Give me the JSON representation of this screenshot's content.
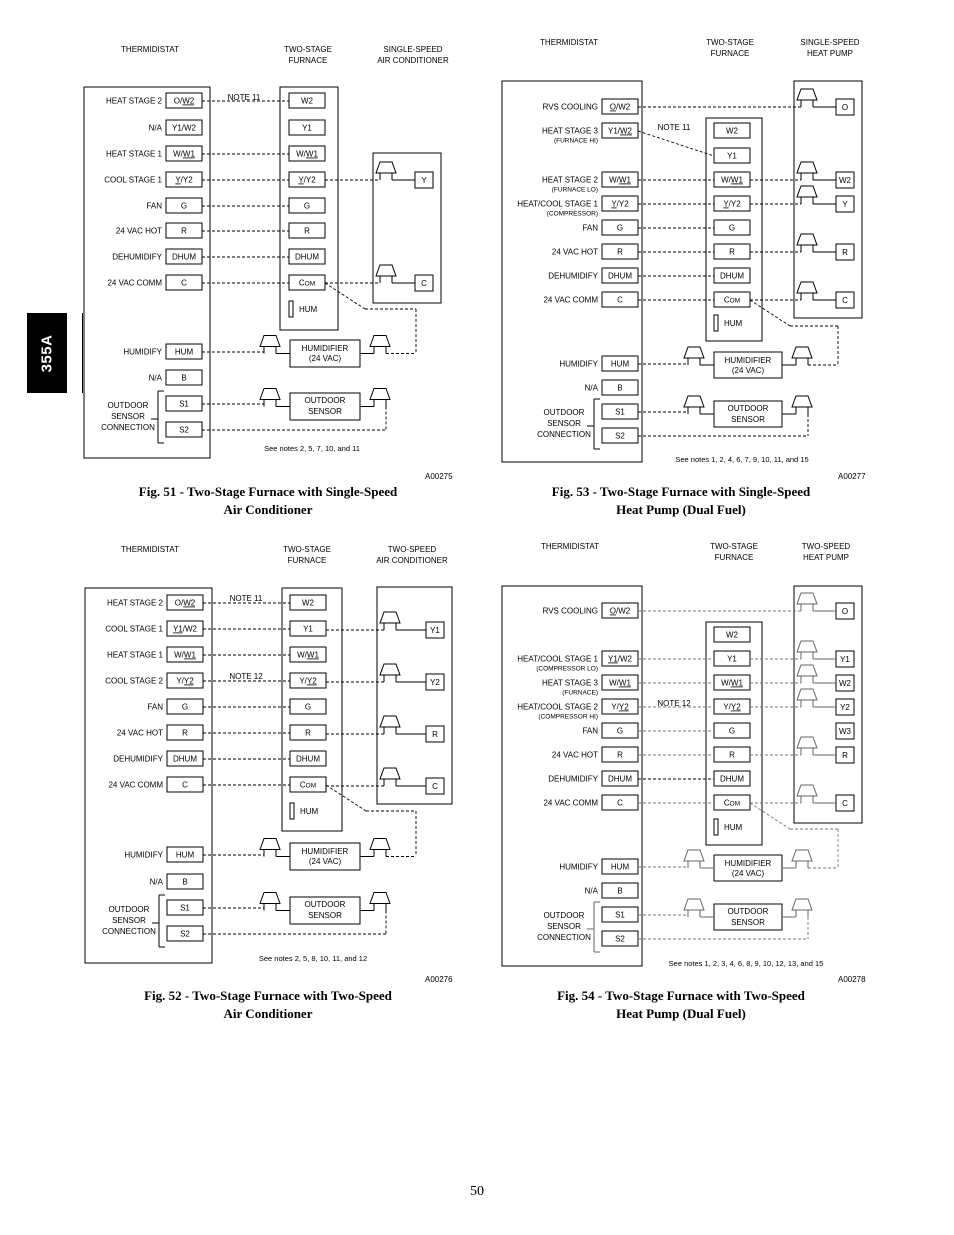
{
  "side_tab": "355A",
  "page_number": "50",
  "figures": [
    {
      "id": "fig51",
      "caption_line1": "Fig. 51 - Two-Stage Furnace with Single-Speed",
      "caption_line2": "Air Conditioner",
      "code": "A00275",
      "notes": "See notes 2, 5, 7, 10, and 11",
      "headers": {
        "thermostat": "THERMIDISTAT",
        "furnace": [
          "TWO-STAGE",
          "FURNACE"
        ],
        "outdoor": [
          "SINGLE-SPEED",
          "AIR CONDITIONER"
        ]
      },
      "thermostat_terminals": [
        {
          "label": "HEAT STAGE 2",
          "sub": "",
          "terminal": "O/W2",
          "underline": "W2"
        },
        {
          "label": "N/A",
          "sub": "",
          "terminal": "Y1/W2",
          "underline": ""
        },
        {
          "label": "HEAT STAGE 1",
          "sub": "",
          "terminal": "W/W1",
          "underline": "W1"
        },
        {
          "label": "COOL STAGE 1",
          "sub": "",
          "terminal": "Y/Y2",
          "underline": "Y"
        },
        {
          "label": "FAN",
          "sub": "",
          "terminal": "G",
          "underline": ""
        },
        {
          "label": "24 VAC HOT",
          "sub": "",
          "terminal": "R",
          "underline": ""
        },
        {
          "label": "DEHUMIDIFY",
          "sub": "",
          "terminal": "DHUM",
          "underline": ""
        },
        {
          "label": "24 VAC COMM",
          "sub": "",
          "terminal": "C",
          "underline": ""
        }
      ],
      "furnace_terminals": [
        "W2",
        "Y1",
        "W/W1",
        "Y/Y2",
        "G",
        "R",
        "DHUM",
        "COM"
      ],
      "furnace_hum": "HUM",
      "outdoor_terminals": [
        "Y",
        "C"
      ],
      "note_labels": [
        {
          "text": "NOTE 11"
        }
      ],
      "humidify": {
        "label": "HUMIDIFY",
        "terminal": "HUM"
      },
      "na_b": {
        "label": "N/A",
        "terminal": "B"
      },
      "outdoor_sensor_connection": {
        "label": [
          "OUTDOOR",
          "SENSOR",
          "CONNECTION"
        ],
        "s1": "S1",
        "s2": "S2"
      },
      "humidifier_box": [
        "HUMIDIFIER",
        "(24 VAC)"
      ],
      "sensor_box": [
        "OUTDOOR",
        "SENSOR"
      ]
    },
    {
      "id": "fig53",
      "caption_line1": "Fig. 53 - Two-Stage Furnace with Single-Speed",
      "caption_line2": "Heat Pump (Dual Fuel)",
      "code": "A00277",
      "notes": "See notes 1, 2, 4, 6, 7, 9, 10, 11, and 15",
      "headers": {
        "thermostat": "THERMIDISTAT",
        "furnace": [
          "TWO-STAGE",
          "FURNACE"
        ],
        "outdoor": [
          "SINGLE-SPEED",
          "HEAT PUMP"
        ]
      },
      "thermostat_terminals": [
        {
          "label": "RVS COOLING",
          "sub": "",
          "terminal": "O/W2",
          "underline": "O"
        },
        {
          "label": "HEAT STAGE 3",
          "sub": "(FURNACE HI)",
          "terminal": "Y1/W2",
          "underline": "W2"
        },
        {
          "label": "HEAT STAGE 2",
          "sub": "(FURNACE LO)",
          "terminal": "W/W1",
          "underline": "W1"
        },
        {
          "label": "HEAT/COOL STAGE 1",
          "sub": "(COMPRESSOR)",
          "terminal": "Y/Y2",
          "underline": "Y"
        },
        {
          "label": "FAN",
          "sub": "",
          "terminal": "G",
          "underline": ""
        },
        {
          "label": "24 VAC HOT",
          "sub": "",
          "terminal": "R",
          "underline": ""
        },
        {
          "label": "DEHUMIDIFY",
          "sub": "",
          "terminal": "DHUM",
          "underline": ""
        },
        {
          "label": "24 VAC COMM",
          "sub": "",
          "terminal": "C",
          "underline": ""
        }
      ],
      "furnace_terminals": [
        "W2",
        "Y1",
        "W/W1",
        "Y/Y2",
        "G",
        "R",
        "DHUM",
        "COM"
      ],
      "furnace_hum": "HUM",
      "outdoor_terminals": [
        "O",
        "W2",
        "Y",
        "R",
        "C"
      ],
      "note_labels": [
        {
          "text": "NOTE 11"
        }
      ],
      "humidify": {
        "label": "HUMIDIFY",
        "terminal": "HUM"
      },
      "na_b": {
        "label": "N/A",
        "terminal": "B"
      },
      "outdoor_sensor_connection": {
        "label": [
          "OUTDOOR",
          "SENSOR",
          "CONNECTION"
        ],
        "s1": "S1",
        "s2": "S2"
      },
      "humidifier_box": [
        "HUMIDIFIER",
        "(24 VAC)"
      ],
      "sensor_box": [
        "OUTDOOR",
        "SENSOR"
      ]
    },
    {
      "id": "fig52",
      "caption_line1": "Fig. 52 - Two-Stage Furnace with Two-Speed",
      "caption_line2": "Air Conditioner",
      "code": "A00276",
      "notes": "See notes 2, 5, 8, 10, 11, and 12",
      "headers": {
        "thermostat": "THERMIDISTAT",
        "furnace": [
          "TWO-STAGE",
          "FURNACE"
        ],
        "outdoor": [
          "TWO-SPEED",
          "AIR CONDITIONER"
        ]
      },
      "thermostat_terminals": [
        {
          "label": "HEAT STAGE 2",
          "sub": "",
          "terminal": "O/W2",
          "underline": "W2"
        },
        {
          "label": "COOL STAGE 1",
          "sub": "",
          "terminal": "Y1/W2",
          "underline": "Y1"
        },
        {
          "label": "HEAT STAGE 1",
          "sub": "",
          "terminal": "W/W1",
          "underline": "W1"
        },
        {
          "label": "COOL STAGE 2",
          "sub": "",
          "terminal": "Y/Y2",
          "underline": "Y2"
        },
        {
          "label": "FAN",
          "sub": "",
          "terminal": "G",
          "underline": ""
        },
        {
          "label": "24 VAC HOT",
          "sub": "",
          "terminal": "R",
          "underline": ""
        },
        {
          "label": "DEHUMIDIFY",
          "sub": "",
          "terminal": "DHUM",
          "underline": ""
        },
        {
          "label": "24 VAC COMM",
          "sub": "",
          "terminal": "C",
          "underline": ""
        }
      ],
      "furnace_terminals": [
        "W2",
        "Y1",
        "W/W1",
        "Y/Y2",
        "G",
        "R",
        "DHUM",
        "COM"
      ],
      "furnace_hum": "HUM",
      "outdoor_terminals": [
        "Y1",
        "Y2",
        "R",
        "C"
      ],
      "note_labels": [
        {
          "text": "NOTE 11"
        },
        {
          "text": "NOTE 12"
        }
      ],
      "humidify": {
        "label": "HUMIDIFY",
        "terminal": "HUM"
      },
      "na_b": {
        "label": "N/A",
        "terminal": "B"
      },
      "outdoor_sensor_connection": {
        "label": [
          "OUTDOOR",
          "SENSOR",
          "CONNECTION"
        ],
        "s1": "S1",
        "s2": "S2"
      },
      "humidifier_box": [
        "HUMIDIFIER",
        "(24 VAC)"
      ],
      "sensor_box": [
        "OUTDOOR",
        "SENSOR"
      ]
    },
    {
      "id": "fig54",
      "caption_line1": "Fig. 54 - Two-Stage Furnace with Two-Speed",
      "caption_line2": "Heat Pump (Dual Fuel)",
      "code": "A00278",
      "notes": "See notes 1, 2, 3, 4, 6, 8, 9, 10, 12, 13, and 15",
      "headers": {
        "thermostat": "THERMIDISTAT",
        "furnace": [
          "TWO-STAGE",
          "FURNACE"
        ],
        "outdoor": [
          "TWO-SPEED",
          "HEAT PUMP"
        ]
      },
      "thermostat_terminals": [
        {
          "label": "RVS COOLING",
          "sub": "",
          "terminal": "O/W2",
          "underline": "O"
        },
        {
          "label": "HEAT/COOL STAGE 1",
          "sub": "(COMPRESSOR LO)",
          "terminal": "Y1/W2",
          "underline": "Y1"
        },
        {
          "label": "HEAT STAGE 3",
          "sub": "(FURNACE)",
          "terminal": "W/W1",
          "underline": "W1"
        },
        {
          "label": "HEAT/COOL STAGE 2",
          "sub": "(COMPRESSOR HI)",
          "terminal": "Y/Y2",
          "underline": "Y2"
        },
        {
          "label": "FAN",
          "sub": "",
          "terminal": "G",
          "underline": ""
        },
        {
          "label": "24 VAC HOT",
          "sub": "",
          "terminal": "R",
          "underline": ""
        },
        {
          "label": "DEHUMIDIFY",
          "sub": "",
          "terminal": "DHUM",
          "underline": ""
        },
        {
          "label": "24 VAC COMM",
          "sub": "",
          "terminal": "C",
          "underline": ""
        }
      ],
      "furnace_terminals": [
        "W2",
        "Y1",
        "W/W1",
        "Y/Y2",
        "G",
        "R",
        "DHUM",
        "COM"
      ],
      "furnace_hum": "HUM",
      "outdoor_terminals": [
        "O",
        "Y1",
        "W2",
        "Y2",
        "W3",
        "R",
        "C"
      ],
      "note_labels": [
        {
          "text": "NOTE 12"
        }
      ],
      "humidify": {
        "label": "HUMIDIFY",
        "terminal": "HUM"
      },
      "na_b": {
        "label": "N/A",
        "terminal": "B"
      },
      "outdoor_sensor_connection": {
        "label": [
          "OUTDOOR",
          "SENSOR",
          "CONNECTION"
        ],
        "s1": "S1",
        "s2": "S2"
      },
      "humidifier_box": [
        "HUMIDIFIER",
        "(24 VAC)"
      ],
      "sensor_box": [
        "OUTDOOR",
        "SENSOR"
      ]
    }
  ]
}
